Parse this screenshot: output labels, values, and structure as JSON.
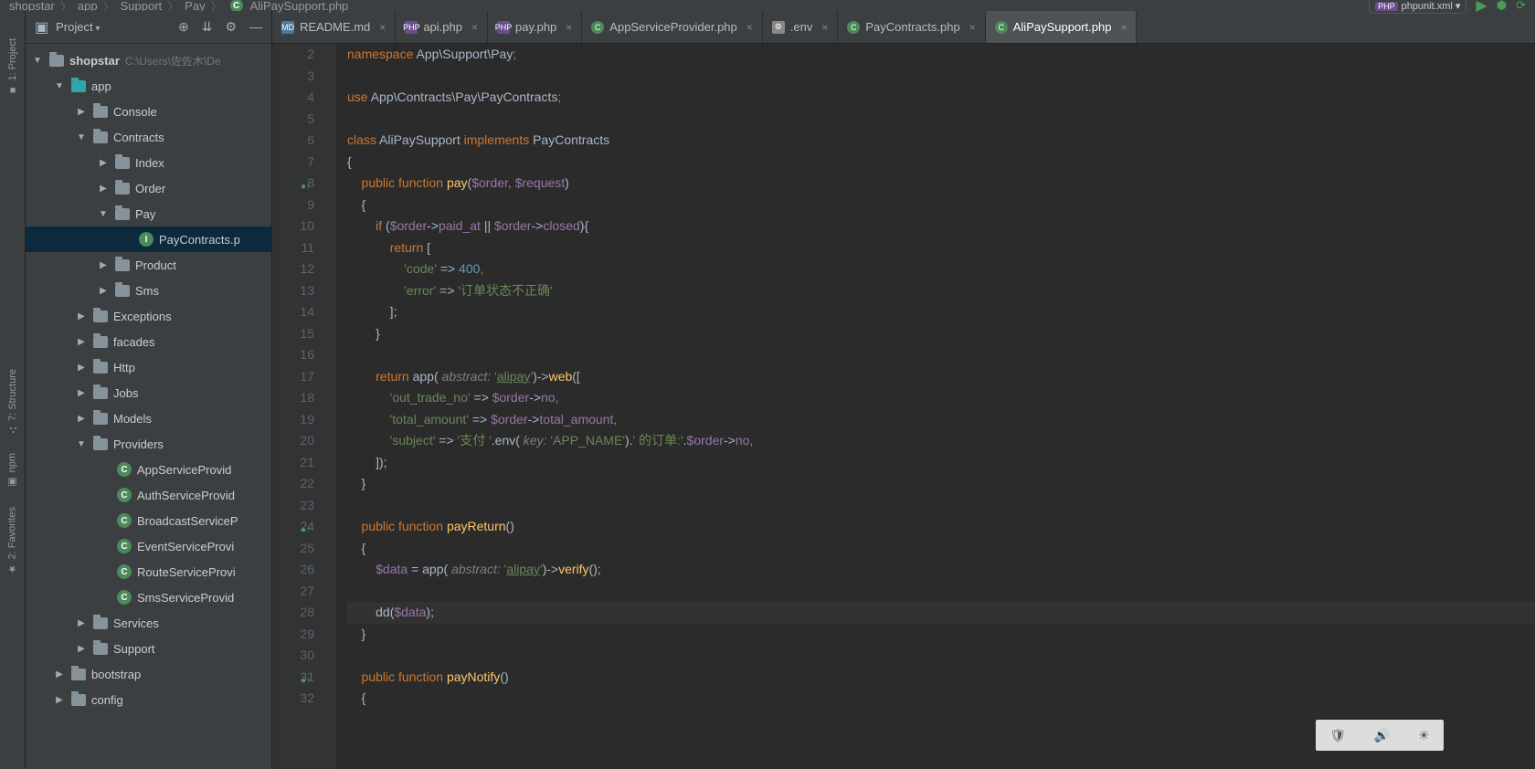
{
  "breadcrumb": [
    "shopstar",
    "app",
    "Support",
    "Pay",
    "AliPaySupport.php"
  ],
  "topRight": {
    "config": "phpunit.xml"
  },
  "panel": {
    "title": "Project",
    "root": "shopstar",
    "rootPath": "C:\\Users\\佐佐木\\De"
  },
  "tree": {
    "app": "app",
    "console": "Console",
    "contracts": "Contracts",
    "index": "Index",
    "order": "Order",
    "pay": "Pay",
    "payContracts": "PayContracts.p",
    "product": "Product",
    "sms": "Sms",
    "exceptions": "Exceptions",
    "facades": "facades",
    "http": "Http",
    "jobs": "Jobs",
    "models": "Models",
    "providers": "Providers",
    "appSP": "AppServiceProvid",
    "authSP": "AuthServiceProvid",
    "broadcastSP": "BroadcastServiceP",
    "eventSP": "EventServiceProvi",
    "routeSP": "RouteServiceProvi",
    "smsSP": "SmsServiceProvid",
    "services": "Services",
    "support": "Support",
    "bootstrap": "bootstrap",
    "config": "config"
  },
  "tabs": [
    {
      "label": "README.md",
      "type": "md"
    },
    {
      "label": "api.php",
      "type": "php"
    },
    {
      "label": "pay.php",
      "type": "php"
    },
    {
      "label": "AppServiceProvider.php",
      "type": "class"
    },
    {
      "label": ".env",
      "type": "env"
    },
    {
      "label": "PayContracts.php",
      "type": "class"
    },
    {
      "label": "AliPaySupport.php",
      "type": "class",
      "active": true
    }
  ],
  "gutter": {
    "start": 2,
    "end": 32,
    "markers": {
      "8": "●↑",
      "24": "●↑",
      "31": "●↑"
    }
  },
  "code": {
    "l2a": "namespace ",
    "l2b": "App\\Support\\Pay",
    "l2c": ";",
    "l4a": "use ",
    "l4b": "App\\Contracts\\Pay\\PayContracts",
    "l4c": ";",
    "l6a": "class ",
    "l6b": "AliPaySupport ",
    "l6c": "implements ",
    "l6d": "PayContracts",
    "l7": "{",
    "l8a": "    public function ",
    "l8b": "pay",
    "l8c": "(",
    "l8d": "$order",
    "l8e": ", ",
    "l8f": "$request",
    "l8g": ")",
    "l9": "    {",
    "l10a": "        if ",
    "l10b": "(",
    "l10c": "$order",
    "l10d": "->",
    "l10e": "paid_at ",
    "l10f": "|| ",
    "l10g": "$order",
    "l10h": "->",
    "l10i": "closed",
    "l10j": "){",
    "l11a": "            return ",
    "l11b": "[",
    "l12a": "                'code' ",
    "l12b": "=> ",
    "l12c": "400",
    "l12d": ",",
    "l13a": "                'error' ",
    "l13b": "=> ",
    "l13c": "'订单状态不正确'",
    "l14": "            ];",
    "l15": "        }",
    "l17a": "        return ",
    "l17b": "app( ",
    "l17c": "abstract: ",
    "l17d": "'",
    "l17e": "alipay",
    "l17f": "'",
    "l17g": ")->",
    "l17h": "web",
    "l17i": "([",
    "l18a": "            'out_trade_no' ",
    "l18b": "=> ",
    "l18c": "$order",
    "l18d": "->",
    "l18e": "no",
    "l18f": ",",
    "l19a": "            'total_amount' ",
    "l19b": "=> ",
    "l19c": "$order",
    "l19d": "->",
    "l19e": "total_amount",
    "l19f": ",",
    "l20a": "            'subject' ",
    "l20b": "=> ",
    "l20c": "'支付 '",
    "l20d": ".",
    "l20e": "env( ",
    "l20f": "key: ",
    "l20g": "'APP_NAME'",
    "l20h": ").",
    "l20i": "' 的订单:'",
    "l20j": ".",
    "l20k": "$order",
    "l20l": "->",
    "l20m": "no",
    "l20n": ",",
    "l21": "        ]);",
    "l22": "    }",
    "l24a": "    public function ",
    "l24b": "payReturn",
    "l24c": "()",
    "l25": "    {",
    "l26a": "        $data ",
    "l26b": "= ",
    "l26c": "app( ",
    "l26d": "abstract: ",
    "l26e": "'",
    "l26f": "alipay",
    "l26g": "'",
    "l26h": ")->",
    "l26i": "verify",
    "l26j": "();",
    "l28a": "        dd(",
    "l28b": "$data",
    "l28c": ");",
    "l29": "    }",
    "l31a": "    public function ",
    "l31b": "payNotify",
    "l31c": "()",
    "l32": "    {"
  },
  "rails": {
    "project": "1: Project",
    "structure": "7: Structure",
    "npm": "npm",
    "favorites": "2: Favorites"
  }
}
